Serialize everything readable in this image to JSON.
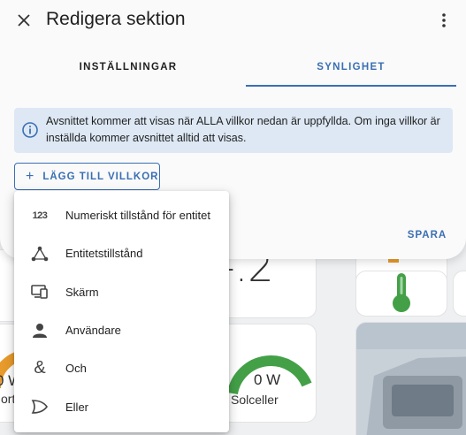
{
  "dialog": {
    "title": "Redigera sektion",
    "close_icon": "close-icon",
    "menu_icon": "dots-vertical-icon",
    "tabs": [
      {
        "label": "INSTÄLLNINGAR",
        "active": false
      },
      {
        "label": "SYNLIGHET",
        "active": true
      }
    ],
    "info": {
      "icon": "info-icon",
      "text": "Avsnittet kommer att visas när ALLA villkor nedan är uppfyllda. Om inga villkor är inställda kommer avsnittet alltid att visas."
    },
    "add_condition_label": "LÄGG TILL VILLKOR",
    "save_label": "SPARA"
  },
  "condition_menu": {
    "items": [
      {
        "label": "Numeriskt tillstånd för entitet",
        "icon": "numeric-icon",
        "icon_text": "123"
      },
      {
        "label": "Entitetstillstånd",
        "icon": "state-machine-icon"
      },
      {
        "label": "Skärm",
        "icon": "monitor-icon"
      },
      {
        "label": "Användare",
        "icon": "account-icon"
      },
      {
        "label": "Och",
        "icon": "ampersand-icon",
        "icon_text": "&"
      },
      {
        "label": "Eller",
        "icon": "gate-or-icon"
      }
    ]
  },
  "background": {
    "partial_big_value": "-.2",
    "gauge_left_value": "0 W",
    "gauge_left_label": "ort",
    "gauge_right_value": "0 W",
    "gauge_right_label": "Solceller"
  },
  "colors": {
    "accent": "#3a6fb4",
    "info_bg": "#dde8f4",
    "gauge_green": "#43a047",
    "gauge_orange": "#e89b2c"
  }
}
